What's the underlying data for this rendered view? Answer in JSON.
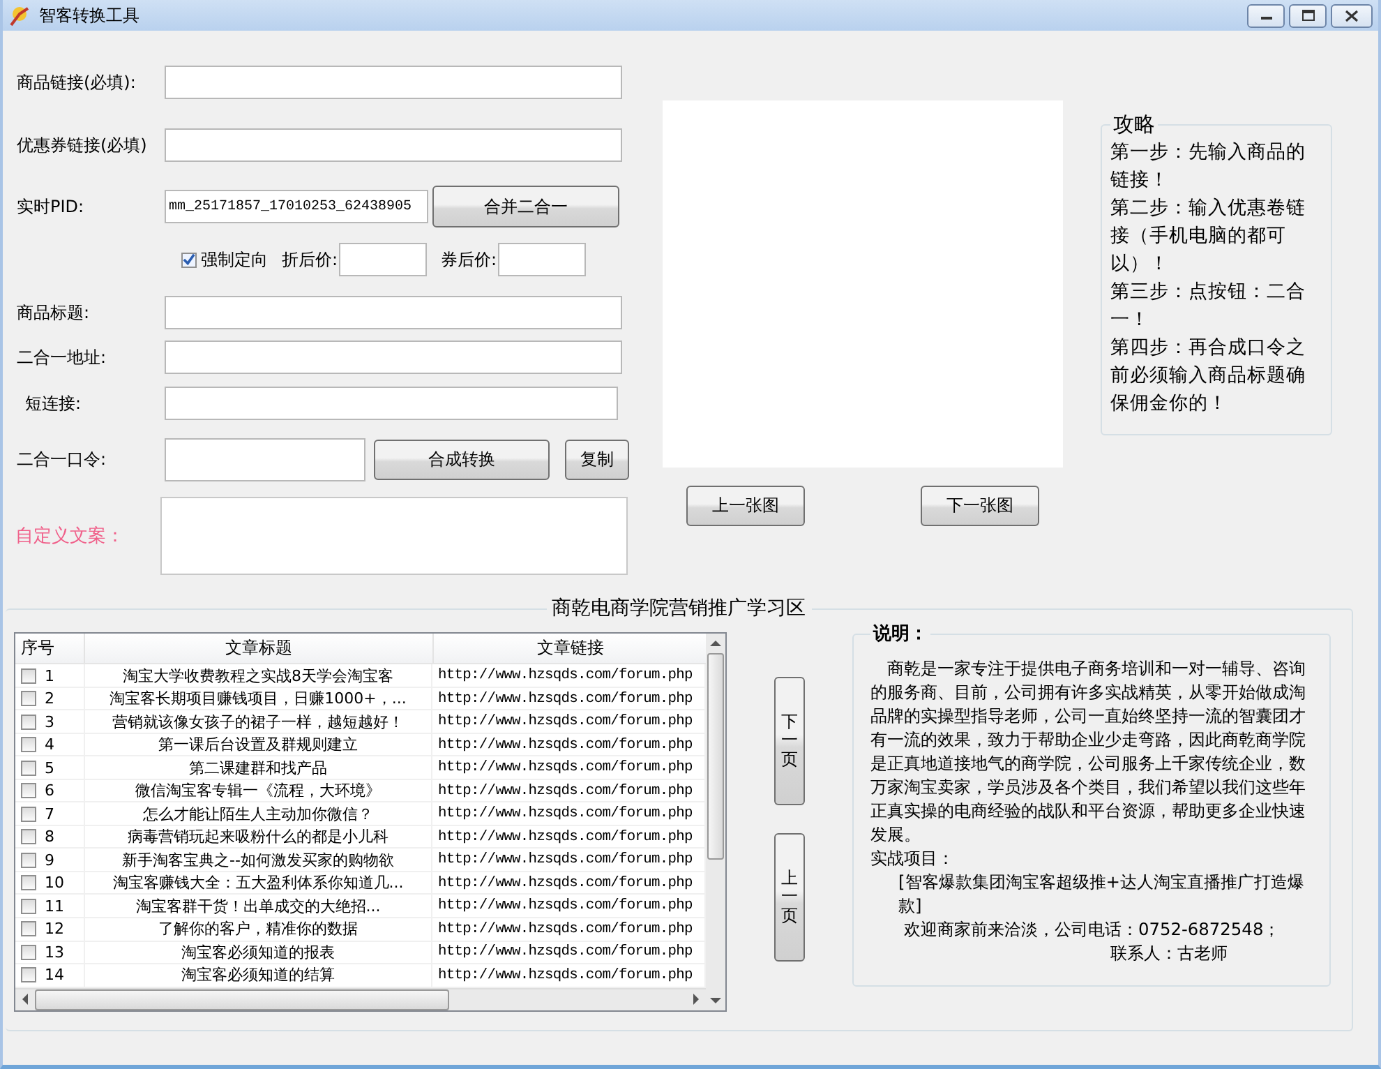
{
  "window": {
    "title": "智客转换工具"
  },
  "form": {
    "product_link": {
      "label": "商品链接(必填):"
    },
    "coupon_link": {
      "label": "优惠券链接(必填)"
    },
    "pid": {
      "label": "实时PID:",
      "value": "mm_25171857_17010253_62438905",
      "button": "合并二合一"
    },
    "forced": {
      "label": "强制定向",
      "checked": true
    },
    "discount_price": {
      "label": "折后价:"
    },
    "coupon_price": {
      "label": "券后价:"
    },
    "title": {
      "label": "商品标题:"
    },
    "merged_url": {
      "label": "二合一地址:"
    },
    "short_link": {
      "label": "短连接:"
    },
    "token": {
      "label": "二合一口令:",
      "convert_button": "合成转换",
      "copy_button": "复制"
    },
    "custom_copy": {
      "label": "自定义文案："
    }
  },
  "image_nav": {
    "prev": "上一张图",
    "next": "下一张图"
  },
  "guide": {
    "title": "攻略",
    "steps": [
      "第一步：先输入商品的链接！",
      "第二步：输入优惠卷链接（手机电脑的都可以）！",
      "第三步：点按钮：二合一！",
      "第四步：再合成口令之前必须输入商品标题确保佣金你的！"
    ]
  },
  "learning": {
    "title": "商乾电商学院营销推广学习区",
    "table": {
      "columns": [
        "序号",
        "文章标题",
        "文章链接"
      ],
      "rows": [
        {
          "no": "1",
          "title": "淘宝大学收费教程之实战8天学会淘宝客",
          "link": "http://www.hzsqds.com/forum.php",
          "checked": false
        },
        {
          "no": "2",
          "title": "淘宝客长期项目赚钱项目，日赚1000+，...",
          "link": "http://www.hzsqds.com/forum.php",
          "checked": false
        },
        {
          "no": "3",
          "title": "营销就该像女孩子的裙子一样，越短越好！",
          "link": "http://www.hzsqds.com/forum.php",
          "checked": false
        },
        {
          "no": "4",
          "title": "第一课后台设置及群规则建立",
          "link": "http://www.hzsqds.com/forum.php",
          "checked": false
        },
        {
          "no": "5",
          "title": "第二课建群和找产品",
          "link": "http://www.hzsqds.com/forum.php",
          "checked": false
        },
        {
          "no": "6",
          "title": "微信淘宝客专辑一《流程，大环境》",
          "link": "http://www.hzsqds.com/forum.php",
          "checked": false
        },
        {
          "no": "7",
          "title": "怎么才能让陌生人主动加你微信？",
          "link": "http://www.hzsqds.com/forum.php",
          "checked": false
        },
        {
          "no": "8",
          "title": "病毒营销玩起来吸粉什么的都是小儿科",
          "link": "http://www.hzsqds.com/forum.php",
          "checked": false
        },
        {
          "no": "9",
          "title": "新手淘客宝典之--如何激发买家的购物欲",
          "link": "http://www.hzsqds.com/forum.php",
          "checked": false
        },
        {
          "no": "10",
          "title": "淘宝客赚钱大全：五大盈利体系你知道几...",
          "link": "http://www.hzsqds.com/forum.php",
          "checked": false
        },
        {
          "no": "11",
          "title": "淘宝客群干货！出单成交的大绝招...",
          "link": "http://www.hzsqds.com/forum.php",
          "checked": false
        },
        {
          "no": "12",
          "title": "了解你的客户，精准你的数据",
          "link": "http://www.hzsqds.com/forum.php",
          "checked": false
        },
        {
          "no": "13",
          "title": "淘宝客必须知道的报表",
          "link": "http://www.hzsqds.com/forum.php",
          "checked": false
        },
        {
          "no": "14",
          "title": "淘宝客必须知道的结算",
          "link": "http://www.hzsqds.com/forum.php",
          "checked": false
        }
      ]
    },
    "page_buttons": [
      "下一页",
      "上一页"
    ],
    "description": {
      "title": "说明：",
      "paragraphs": [
        {
          "kind": "body",
          "text": "商乾是一家专注于提供电子商务培训和一对一辅导、咨询的服务商、目前，公司拥有许多实战精英，从零开始做成淘品牌的实操型指导老师，公司一直始终坚持一流的智囊团才有一流的效果，致力于帮助企业少走弯路，因此商乾商学院是正真地道接地气的商学院，公司服务上千家传统企业，数万家淘宝卖家，学员涉及各个类目，我们希望以我们这些年正真实操的电商经验的战队和平台资源，帮助更多企业快速发展。"
        },
        {
          "kind": "heading",
          "text": "实战项目："
        },
        {
          "kind": "project",
          "text": "[智客爆款集团淘宝客超级推+达人淘宝直播推广打造爆款]"
        },
        {
          "kind": "contact",
          "text": "欢迎商家前来洽淡，公司电话：0752-6872548；"
        },
        {
          "kind": "signature",
          "text": "联系人：古老师"
        }
      ]
    }
  }
}
